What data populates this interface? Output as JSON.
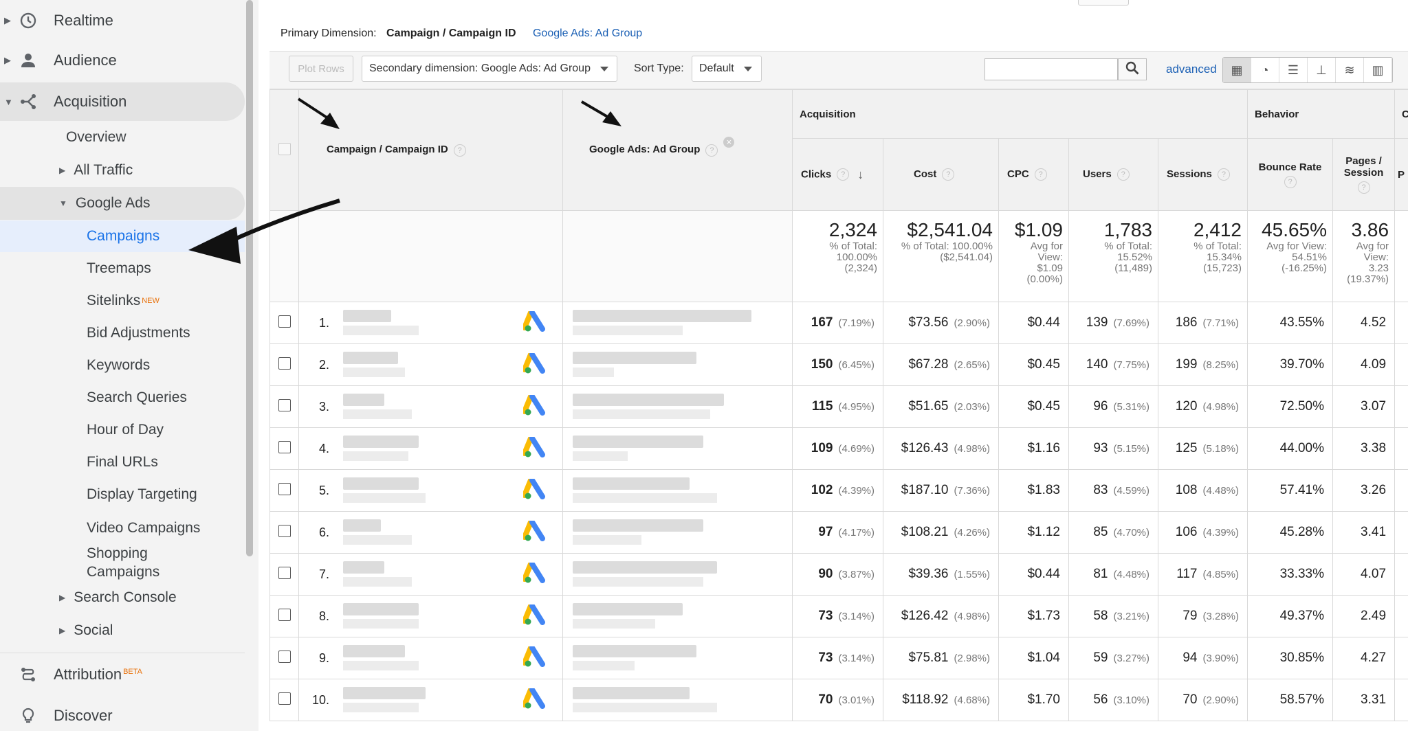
{
  "sidebar": {
    "items": [
      {
        "label": "Realtime",
        "icon": "clock-icon"
      },
      {
        "label": "Audience",
        "icon": "person-icon"
      },
      {
        "label": "Acquisition",
        "icon": "acquisition-icon"
      }
    ],
    "acquisition_children": [
      "Overview",
      "All Traffic",
      "Google Ads"
    ],
    "google_ads_children": [
      "Campaigns",
      "Treemaps",
      "Sitelinks",
      "Bid Adjustments",
      "Keywords",
      "Search Queries",
      "Hour of Day",
      "Final URLs",
      "Display Targeting",
      "Video Campaigns",
      "Shopping Campaigns"
    ],
    "sitelinks_badge": "NEW",
    "more_children": [
      "Search Console",
      "Social"
    ],
    "attribution": "Attribution",
    "attribution_badge": "BETA",
    "discover": "Discover"
  },
  "main": {
    "primary_dimension_label": "Primary Dimension:",
    "primary_dimension_value": "Campaign / Campaign ID",
    "alt_dimension_link": "Google Ads: Ad Group",
    "toolbar": {
      "plot_rows": "Plot Rows",
      "secondary_dimension": "Secondary dimension: Google Ads: Ad Group",
      "sort_type_label": "Sort Type:",
      "sort_type_value": "Default",
      "advanced": "advanced"
    },
    "table": {
      "col_campaign": "Campaign / Campaign ID",
      "col_adgroup": "Google Ads: Ad Group",
      "group_acquisition": "Acquisition",
      "group_behavior": "Behavior",
      "group_next": "C",
      "headers": [
        "Clicks",
        "Cost",
        "CPC",
        "Users",
        "Sessions",
        "Bounce Rate",
        "Pages / Session",
        "P"
      ],
      "totals": [
        {
          "value": "2,324",
          "sub": [
            "% of Total:",
            "100.00%",
            "(2,324)"
          ]
        },
        {
          "value": "$2,541.04",
          "sub": [
            "% of Total: 100.00%",
            "($2,541.04)"
          ]
        },
        {
          "value": "$1.09",
          "sub": [
            "Avg for",
            "View:",
            "$1.09",
            "(0.00%)"
          ]
        },
        {
          "value": "1,783",
          "sub": [
            "% of Total:",
            "15.52%",
            "(11,489)"
          ]
        },
        {
          "value": "2,412",
          "sub": [
            "% of Total:",
            "15.34%",
            "(15,723)"
          ]
        },
        {
          "value": "45.65%",
          "sub": [
            "Avg for View:",
            "54.51%",
            "(-16.25%)"
          ]
        },
        {
          "value": "3.86",
          "sub": [
            "Avg for",
            "View:",
            "3.23",
            "(19.37%)"
          ]
        }
      ],
      "rows": [
        {
          "idx": "1.",
          "clicks": "167",
          "clicks_p": "(7.19%)",
          "cost": "$73.56",
          "cost_p": "(2.90%)",
          "cpc": "$0.44",
          "users": "139",
          "users_p": "(7.69%)",
          "sessions": "186",
          "sessions_p": "(7.71%)",
          "bounce": "43.55%",
          "pps": "4.52"
        },
        {
          "idx": "2.",
          "clicks": "150",
          "clicks_p": "(6.45%)",
          "cost": "$67.28",
          "cost_p": "(2.65%)",
          "cpc": "$0.45",
          "users": "140",
          "users_p": "(7.75%)",
          "sessions": "199",
          "sessions_p": "(8.25%)",
          "bounce": "39.70%",
          "pps": "4.09"
        },
        {
          "idx": "3.",
          "clicks": "115",
          "clicks_p": "(4.95%)",
          "cost": "$51.65",
          "cost_p": "(2.03%)",
          "cpc": "$0.45",
          "users": "96",
          "users_p": "(5.31%)",
          "sessions": "120",
          "sessions_p": "(4.98%)",
          "bounce": "72.50%",
          "pps": "3.07"
        },
        {
          "idx": "4.",
          "clicks": "109",
          "clicks_p": "(4.69%)",
          "cost": "$126.43",
          "cost_p": "(4.98%)",
          "cpc": "$1.16",
          "users": "93",
          "users_p": "(5.15%)",
          "sessions": "125",
          "sessions_p": "(5.18%)",
          "bounce": "44.00%",
          "pps": "3.38"
        },
        {
          "idx": "5.",
          "clicks": "102",
          "clicks_p": "(4.39%)",
          "cost": "$187.10",
          "cost_p": "(7.36%)",
          "cpc": "$1.83",
          "users": "83",
          "users_p": "(4.59%)",
          "sessions": "108",
          "sessions_p": "(4.48%)",
          "bounce": "57.41%",
          "pps": "3.26"
        },
        {
          "idx": "6.",
          "clicks": "97",
          "clicks_p": "(4.17%)",
          "cost": "$108.21",
          "cost_p": "(4.26%)",
          "cpc": "$1.12",
          "users": "85",
          "users_p": "(4.70%)",
          "sessions": "106",
          "sessions_p": "(4.39%)",
          "bounce": "45.28%",
          "pps": "3.41"
        },
        {
          "idx": "7.",
          "clicks": "90",
          "clicks_p": "(3.87%)",
          "cost": "$39.36",
          "cost_p": "(1.55%)",
          "cpc": "$0.44",
          "users": "81",
          "users_p": "(4.48%)",
          "sessions": "117",
          "sessions_p": "(4.85%)",
          "bounce": "33.33%",
          "pps": "4.07"
        },
        {
          "idx": "8.",
          "clicks": "73",
          "clicks_p": "(3.14%)",
          "cost": "$126.42",
          "cost_p": "(4.98%)",
          "cpc": "$1.73",
          "users": "58",
          "users_p": "(3.21%)",
          "sessions": "79",
          "sessions_p": "(3.28%)",
          "bounce": "49.37%",
          "pps": "2.49"
        },
        {
          "idx": "9.",
          "clicks": "73",
          "clicks_p": "(3.14%)",
          "cost": "$75.81",
          "cost_p": "(2.98%)",
          "cpc": "$1.04",
          "users": "59",
          "users_p": "(3.27%)",
          "sessions": "94",
          "sessions_p": "(3.90%)",
          "bounce": "30.85%",
          "pps": "4.27"
        },
        {
          "idx": "10.",
          "clicks": "70",
          "clicks_p": "(3.01%)",
          "cost": "$118.92",
          "cost_p": "(4.68%)",
          "cpc": "$1.70",
          "users": "56",
          "users_p": "(3.10%)",
          "sessions": "70",
          "sessions_p": "(2.90%)",
          "bounce": "58.57%",
          "pps": "3.31"
        }
      ]
    }
  },
  "colors": {
    "selected_bg": "#e6eefc",
    "link": "#1a5fb4",
    "badge": "#e8710a",
    "sidebar_bg": "#f3f3f3"
  }
}
